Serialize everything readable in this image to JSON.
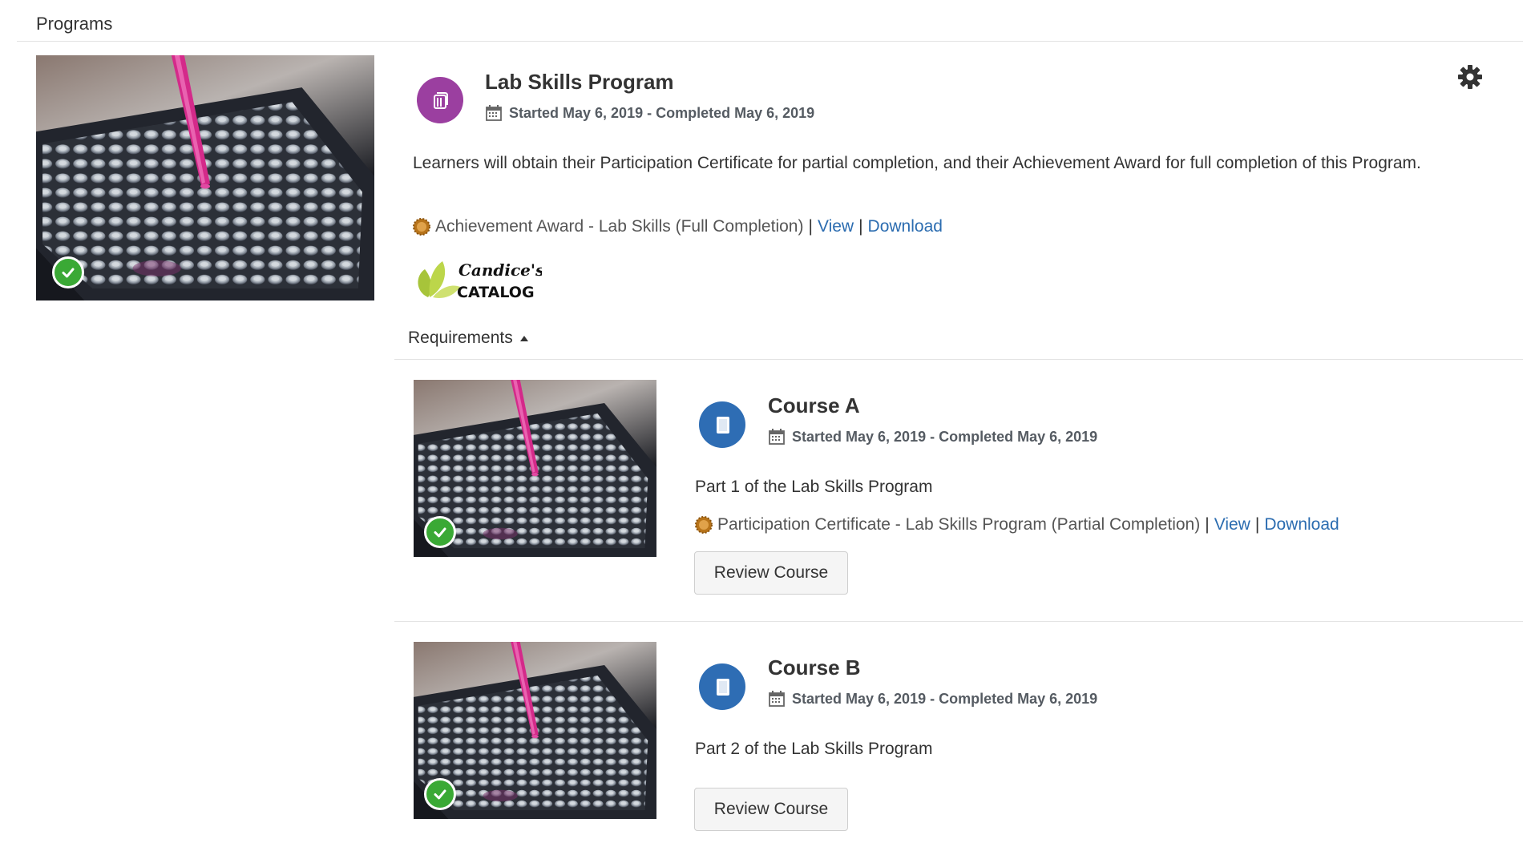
{
  "header": {
    "title": "Programs"
  },
  "program": {
    "title": "Lab Skills Program",
    "dates": "Started May 6, 2019 - Completed May 6, 2019",
    "description": "Learners will obtain their Participation Certificate for partial completion, and their Achievement Award for full completion of this Program.",
    "award": {
      "text": "Achievement Award - Lab Skills (Full Completion)",
      "view_label": "View",
      "download_label": "Download"
    },
    "logo": {
      "line1": "Candice's",
      "line2": "CATALOG"
    },
    "requirements_label": "Requirements"
  },
  "courses": [
    {
      "title": "Course A",
      "dates": "Started May 6, 2019 - Completed May 6, 2019",
      "description": "Part 1 of the Lab Skills Program",
      "award": {
        "text": "Participation Certificate - Lab Skills Program (Partial Completion)",
        "view_label": "View",
        "download_label": "Download"
      },
      "button_label": "Review Course"
    },
    {
      "title": "Course B",
      "dates": "Started May 6, 2019 - Completed May 6, 2019",
      "description": "Part 2 of the Lab Skills Program",
      "button_label": "Review Course"
    }
  ],
  "colors": {
    "program_icon": "#9b3fa0",
    "course_icon": "#2e6db4",
    "check": "#3aa935",
    "link": "#2b6cb0",
    "award_badge": "#b8741a"
  },
  "icons": {
    "settings": "gear-icon",
    "calendar": "calendar-icon",
    "program": "program-books-icon",
    "course": "course-book-icon",
    "completed": "check-circle-icon",
    "award": "award-badge-icon",
    "requirements_toggle": "caret-up-icon"
  }
}
